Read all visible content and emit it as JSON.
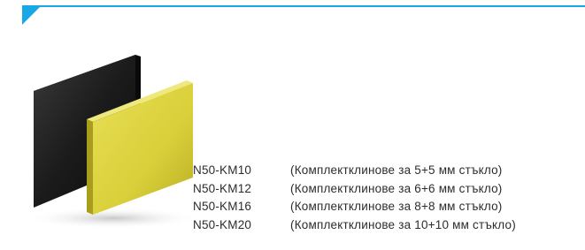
{
  "header": {
    "accent_color": "#19a8e6"
  },
  "product": {
    "image_icon": "black-and-yellow-panels-image",
    "colors": {
      "panel_dark": "#1b1b1b",
      "panel_yellow": "#d9cf3a"
    }
  },
  "codes": [
    {
      "code": "N50-KM10",
      "desc": "(Комплектклинове за 5+5 мм стъкло)"
    },
    {
      "code": "N50-KM12",
      "desc": "(Комплектклинове за 6+6 мм стъкло)"
    },
    {
      "code": "N50-KM16",
      "desc": "(Комплектклинове за 8+8 мм стъкло)"
    },
    {
      "code": "N50-KM20",
      "desc": "(Комплектклинове за 10+10 мм стъкло)"
    }
  ]
}
